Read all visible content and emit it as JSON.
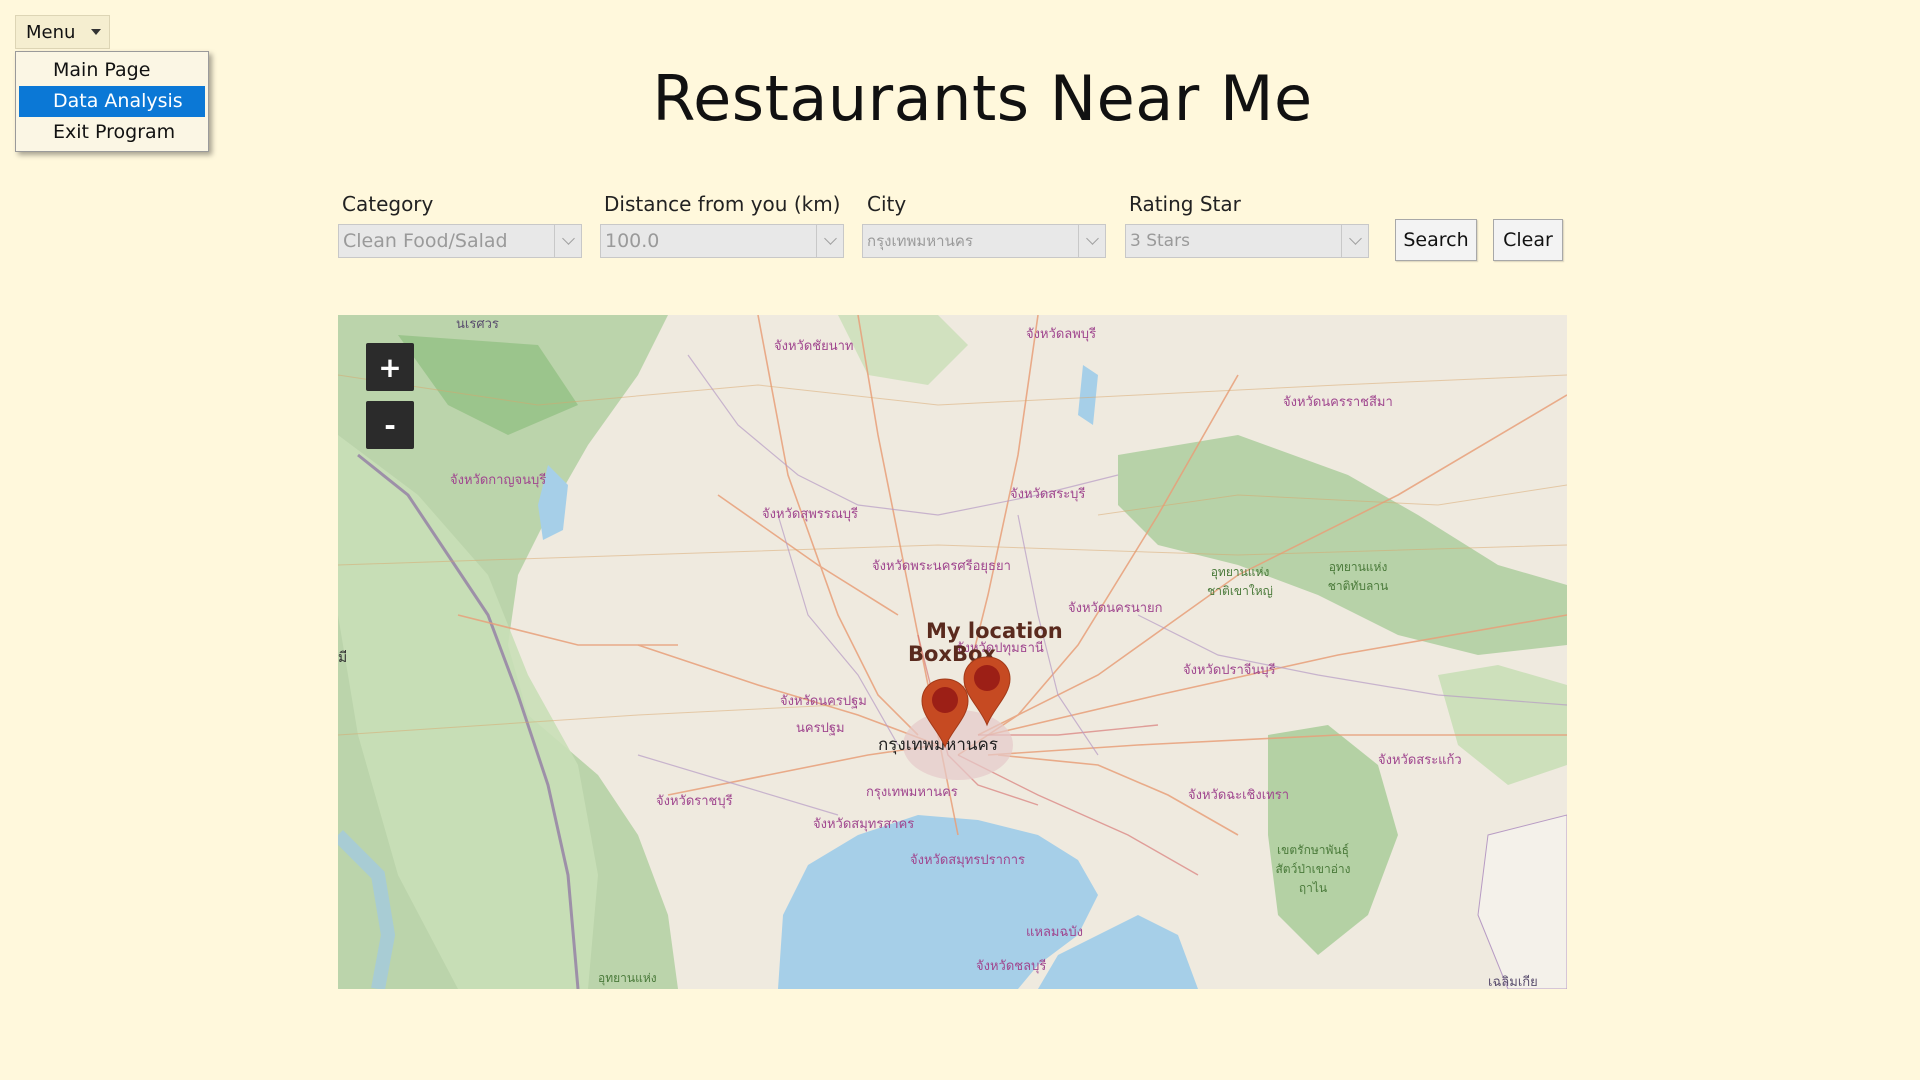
{
  "menu": {
    "button_label": "Menu",
    "items": [
      {
        "label": "Main Page",
        "active": false
      },
      {
        "label": "Data Analysis",
        "active": true
      },
      {
        "label": "Exit Program",
        "active": false
      }
    ]
  },
  "page": {
    "title": "Restaurants Near Me"
  },
  "filters": {
    "category": {
      "label": "Category",
      "value": "Clean Food/Salad"
    },
    "distance": {
      "label": "Distance from you (km)",
      "value": "100.0"
    },
    "city": {
      "label": "City",
      "value": "กรุงเทพมหานคร"
    },
    "rating": {
      "label": "Rating Star",
      "value": "3 Stars"
    }
  },
  "actions": {
    "search_label": "Search",
    "clear_label": "Clear"
  },
  "map": {
    "zoom_in_label": "+",
    "zoom_out_label": "-",
    "markers": [
      {
        "label": "My location",
        "color": "#c8481e"
      },
      {
        "label": "BoxBox",
        "color": "#c8481e"
      }
    ],
    "place_labels": {
      "chainat": "จังหวัดชัยนาท",
      "lopburi": "จังหวัดลพบุรี",
      "nakhon_ratchasima": "จังหวัดนครราชสีมา",
      "kanchanaburi": "จังหวัดกาญจนบุรี",
      "suphanburi": "จังหวัดสุพรรณบุรี",
      "saraburi": "จังหวัดสระบุรี",
      "ayutthaya": "จังหวัดพระนครศรีอยุธยา",
      "nakhon_nayok": "จังหวัดนครนายก",
      "pathum_thani": "จังหวัดปทุมธานี",
      "prachinburi": "จังหวัดปราจีนบุรี",
      "nakhon_pathom": "จังหวัดนครปฐม",
      "nakhon_pathom_town": "นครปฐม",
      "bangkok_city": "กรุงเทพมหานคร",
      "bangkok": "กรุงเทพมหานคร",
      "ratchaburi": "จังหวัดราชบุรี",
      "samut_sakhon": "จังหวัดสมุทรสาคร",
      "samut_prakan": "จังหวัดสมุทรปราการ",
      "chachoengsao": "จังหวัดฉะเชิงเทรา",
      "sa_kaeo": "จังหวัดสระแก้ว",
      "chonburi": "จังหวัดชลบุรี",
      "laem_chabang": "แหลมฉบัง",
      "khao_yai": "อุทยานแห่งชาติเขาใหญ่",
      "thap_lan": "อุทยานแห่งชาติทับลาน",
      "wildlife": "เขตรักษาพันธุ์สัตว์ป่าเขาอ่างฤาไน",
      "national_park_sw": "อุทยานแห่ง",
      "naresuan": "นเรศวร",
      "myanmar_edge": "มี",
      "gulf_right": "เฉลิมเกีย"
    }
  }
}
